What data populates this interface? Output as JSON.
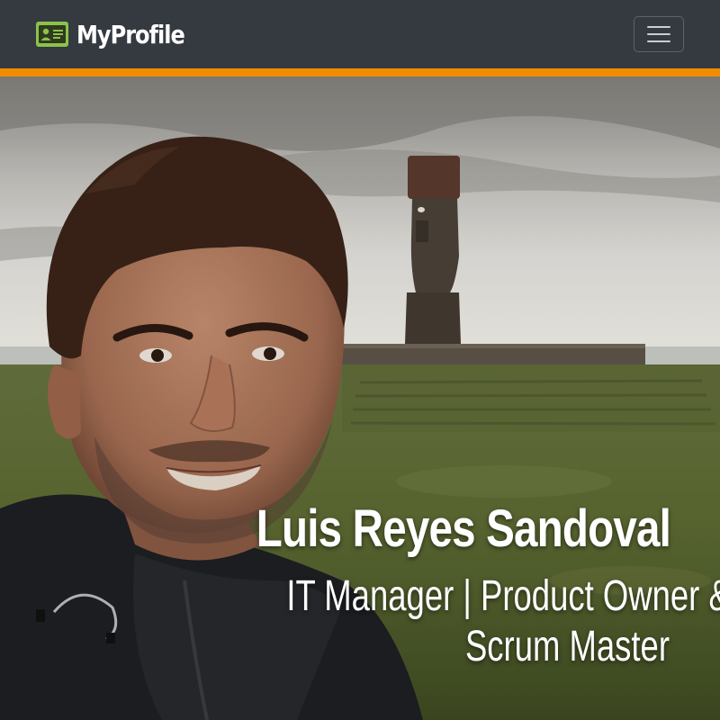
{
  "navbar": {
    "brand": "MyProfile",
    "brand_icon": "id-card-icon",
    "toggle_icon": "hamburger-menu-icon"
  },
  "colors": {
    "navbar_bg": "#343a40",
    "accent": "#f28c00",
    "brand_icon": "#8bc34a",
    "hero_text": "#ffffff"
  },
  "hero": {
    "background": "portrait photo of a man in a dark jacket with a moai statue on a grassy field behind him",
    "name": "Luis Reyes Sandoval",
    "role_line1": "IT Manager | Product Owner &",
    "role_line2": "Scrum Master"
  }
}
